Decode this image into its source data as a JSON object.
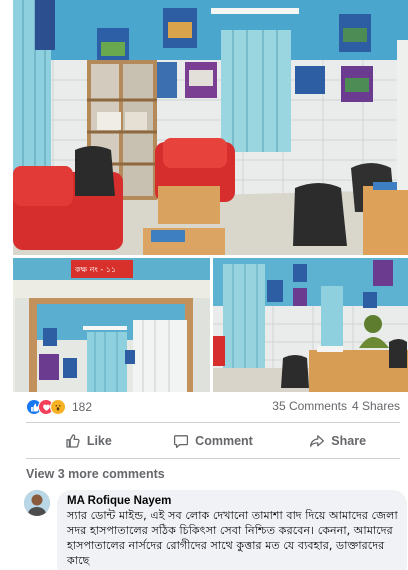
{
  "post": {
    "photos": {
      "main": {
        "description_icon": "office-room-photo"
      },
      "left": {
        "sign_text": "কক্ষ নং - ১১"
      },
      "right": {
        "description_icon": "clinic-desk-photo"
      }
    },
    "reaction_count": "182",
    "comments_count": "35 Comments",
    "shares_count": "4 Shares",
    "actions": {
      "like": "Like",
      "comment": "Comment",
      "share": "Share"
    },
    "view_more": "View 3 more comments"
  },
  "comment": {
    "author": "MA Rofique Nayem",
    "text": "স্যার ডোন্ট মাইন্ড, এই সব লোক দেখানো তামাশা বাদ দিয়ে আমাদের জেলা সদর হাসপাতালের সঠিক চিকিৎসা সেবা নিশ্চিত করবেন। কেননা, আমাদের হাসপাতালের নার্সদের রোগীদের সাথে কুত্তার মত যে ব্যবহার, ডাক্তারদের কাছে"
  },
  "colors": {
    "accent": "#1877f2",
    "love": "#f33e58",
    "wow": "#f7b125",
    "muted_text": "#65676b",
    "comment_bg": "#f0f2f5"
  }
}
